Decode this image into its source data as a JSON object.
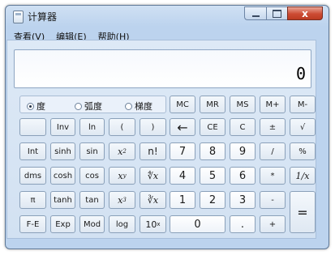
{
  "window": {
    "title": "计算器",
    "controls": {
      "minimize": "minimize",
      "maximize": "maximize",
      "close": "x"
    }
  },
  "menu": [
    {
      "label": "查看(V)"
    },
    {
      "label": "编辑(E)"
    },
    {
      "label": "帮助(H)"
    }
  ],
  "display": {
    "value": "0"
  },
  "angle_modes": [
    {
      "label": "度",
      "selected": true
    },
    {
      "label": "弧度",
      "selected": false
    },
    {
      "label": "梯度",
      "selected": false
    }
  ],
  "keys": {
    "mc": "MC",
    "mr": "MR",
    "ms": "MS",
    "mplus": "M+",
    "mminus": "M-",
    "inv": "Inv",
    "ln": "ln",
    "lparen": "(",
    "rparen": ")",
    "backspace": "←",
    "ce": "CE",
    "c": "C",
    "plusminus": "±",
    "sqrt": "√",
    "int": "Int",
    "sinh": "sinh",
    "sin": "sin",
    "x2": "x",
    "x2_sup": "2",
    "fact": "n!",
    "n7": "7",
    "n8": "8",
    "n9": "9",
    "div": "/",
    "percent": "%",
    "dms": "dms",
    "cosh": "cosh",
    "cos": "cos",
    "xy": "x",
    "xy_sup": "y",
    "yroot": "∜x",
    "n4": "4",
    "n5": "5",
    "n6": "6",
    "mul": "*",
    "recip": "1/x",
    "pi": "π",
    "tanh": "tanh",
    "tan": "tan",
    "x3": "x",
    "x3_sup": "3",
    "cbrt": "∛x",
    "n1": "1",
    "n2": "2",
    "n3": "3",
    "sub": "-",
    "equals": "=",
    "fe": "F-E",
    "exp": "Exp",
    "mod": "Mod",
    "log": "log",
    "ten": "10",
    "ten_sup": "x",
    "n0": "0",
    "dot": ".",
    "add": "+"
  },
  "colors": {
    "window_frame": "#bcd3ee",
    "close_button": "#cc4b33"
  }
}
